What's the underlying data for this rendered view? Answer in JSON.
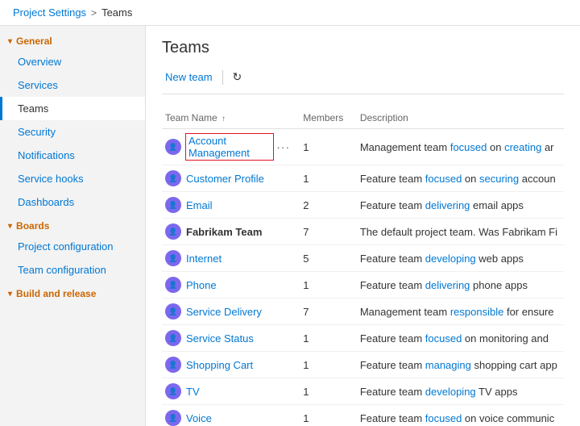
{
  "breadcrumb": {
    "project": "Project Settings",
    "separator": ">",
    "current": "Teams"
  },
  "page_title": "Teams",
  "toolbar": {
    "new_team_label": "New team",
    "refresh_icon": "↻"
  },
  "sidebar": {
    "sections": [
      {
        "id": "general",
        "label": "General",
        "expanded": true,
        "items": [
          {
            "id": "overview",
            "label": "Overview",
            "active": false
          },
          {
            "id": "services",
            "label": "Services",
            "active": false
          },
          {
            "id": "teams",
            "label": "Teams",
            "active": true
          },
          {
            "id": "security",
            "label": "Security",
            "active": false
          },
          {
            "id": "notifications",
            "label": "Notifications",
            "active": false
          },
          {
            "id": "service-hooks",
            "label": "Service hooks",
            "active": false
          },
          {
            "id": "dashboards",
            "label": "Dashboards",
            "active": false
          }
        ]
      },
      {
        "id": "boards",
        "label": "Boards",
        "expanded": true,
        "items": [
          {
            "id": "project-configuration",
            "label": "Project configuration",
            "active": false
          },
          {
            "id": "team-configuration",
            "label": "Team configuration",
            "active": false
          }
        ]
      },
      {
        "id": "build-and-release",
        "label": "Build and release",
        "expanded": false,
        "items": []
      }
    ]
  },
  "table": {
    "columns": [
      {
        "id": "name",
        "label": "Team Name",
        "sortable": true,
        "sort_dir": "asc"
      },
      {
        "id": "members",
        "label": "Members",
        "sortable": false
      },
      {
        "id": "description",
        "label": "Description",
        "sortable": false
      }
    ],
    "rows": [
      {
        "id": "account-management",
        "name": "Account Management",
        "bold": false,
        "selected": true,
        "members": 1,
        "description": "Management team focused on creating ar"
      },
      {
        "id": "customer-profile",
        "name": "Customer Profile",
        "bold": false,
        "selected": false,
        "members": 1,
        "description": "Feature team focused on securing accoun"
      },
      {
        "id": "email",
        "name": "Email",
        "bold": false,
        "selected": false,
        "members": 2,
        "description": "Feature team delivering email apps"
      },
      {
        "id": "fabrikam-team",
        "name": "Fabrikam Team",
        "bold": true,
        "selected": false,
        "members": 7,
        "description": "The default project team. Was Fabrikam Fi"
      },
      {
        "id": "internet",
        "name": "Internet",
        "bold": false,
        "selected": false,
        "members": 5,
        "description": "Feature team developing web apps"
      },
      {
        "id": "phone",
        "name": "Phone",
        "bold": false,
        "selected": false,
        "members": 1,
        "description": "Feature team delivering phone apps"
      },
      {
        "id": "service-delivery",
        "name": "Service Delivery",
        "bold": false,
        "selected": false,
        "members": 7,
        "description": "Management team responsible for ensure"
      },
      {
        "id": "service-status",
        "name": "Service Status",
        "bold": false,
        "selected": false,
        "members": 1,
        "description": "Feature team focused on monitoring and"
      },
      {
        "id": "shopping-cart",
        "name": "Shopping Cart",
        "bold": false,
        "selected": false,
        "members": 1,
        "description": "Feature team managing shopping cart app"
      },
      {
        "id": "tv",
        "name": "TV",
        "bold": false,
        "selected": false,
        "members": 1,
        "description": "Feature team developing TV apps"
      },
      {
        "id": "voice",
        "name": "Voice",
        "bold": false,
        "selected": false,
        "members": 1,
        "description": "Feature team focused on voice communic"
      }
    ]
  }
}
